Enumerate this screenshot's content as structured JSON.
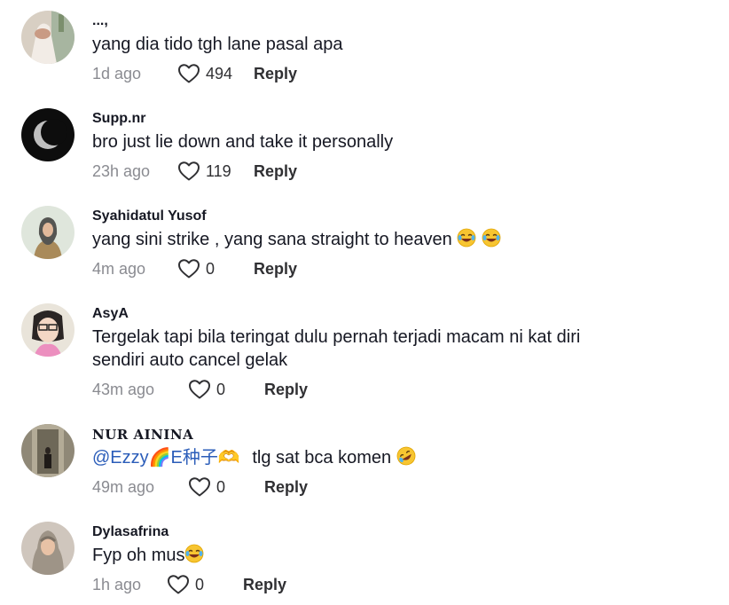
{
  "comments": [
    {
      "username": "...,",
      "text": "yang dia tido tgh lane pasal apa",
      "time": "1d ago",
      "likes": "494",
      "reply": "Reply"
    },
    {
      "username": "Supp.nr",
      "text": "bro just lie down and take it personally",
      "time": "23h ago",
      "likes": "119",
      "reply": "Reply"
    },
    {
      "username": "Syahidatul Yusof",
      "text": "yang sini strike , yang sana straight to heaven",
      "time": "4m ago",
      "likes": "0",
      "reply": "Reply"
    },
    {
      "username": "AsyA",
      "text": "Tergelak tapi bila teringat dulu pernah terjadi macam ni kat diri sendiri auto cancel gelak",
      "time": "43m ago",
      "likes": "0",
      "reply": "Reply"
    },
    {
      "username": "𝐍𝐔𝐑 𝐀𝐈𝐍𝐈𝐍𝐀",
      "mention": "@Ezzy🌈E种子🫶",
      "text": "tlg sat bca komen",
      "time": "49m ago",
      "likes": "0",
      "reply": "Reply"
    },
    {
      "username": "Dylasafrina",
      "text": "Fyp oh mus",
      "time": "1h ago",
      "likes": "0",
      "reply": "Reply"
    }
  ],
  "icons": {
    "like": "heart-outline-icon",
    "laugh": "face-with-tears-of-joy-emoji",
    "rofl": "rolling-on-floor-laughing-emoji"
  }
}
